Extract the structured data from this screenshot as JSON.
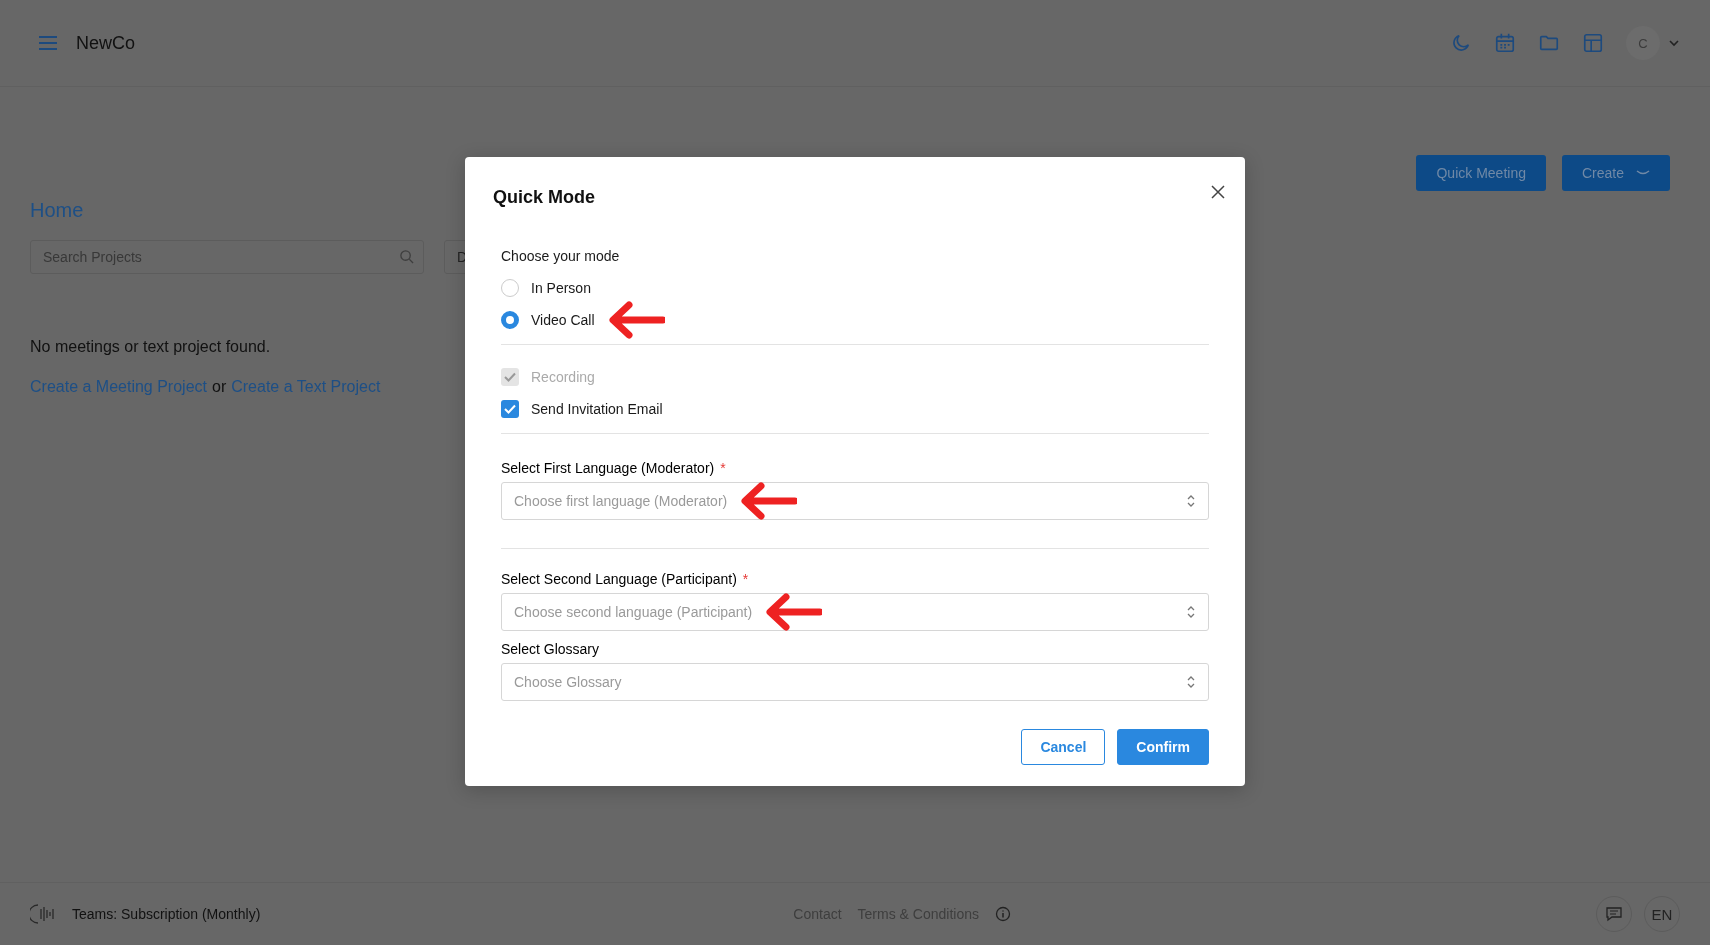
{
  "header": {
    "brand": "NewCo",
    "avatar": "C"
  },
  "actions": [
    {
      "label": "Quick Meeting",
      "kind": "plain"
    },
    {
      "label": "Create",
      "kind": "dropdown"
    }
  ],
  "page": {
    "title": "Home",
    "search": {
      "placeholder": "Search Projects"
    },
    "cut_button": "D",
    "empty_message": "No meetings or text project found.",
    "links": [
      {
        "label": "Create a Meeting Project"
      },
      {
        "label": "Create a Text Project"
      }
    ],
    "joiner": "or"
  },
  "dialog": {
    "title": "Quick Mode",
    "mode_label": "Choose your mode",
    "modes": [
      {
        "label": "In Person",
        "selected": false,
        "arrow": false
      },
      {
        "label": "Video Call",
        "selected": true,
        "arrow": true
      }
    ],
    "options": [
      {
        "label": "Recording",
        "checked": true,
        "disabled": true
      },
      {
        "label": "Send Invitation Email",
        "checked": true,
        "disabled": false
      }
    ],
    "selects": [
      {
        "label": "Select First Language (Moderator)",
        "required_mark": "*",
        "placeholder": "Choose first language (Moderator)",
        "arrow": true,
        "divider_after": true
      },
      {
        "label": "Select Second Language (Participant)",
        "required_mark": "*",
        "placeholder": "Choose second language (Participant)",
        "arrow": true,
        "divider_after": false
      },
      {
        "label": "Select Glossary",
        "placeholder": "Choose Glossary",
        "arrow": false,
        "divider_after": false
      }
    ],
    "buttons": [
      {
        "label": "Cancel",
        "kind": "secondary"
      },
      {
        "label": "Confirm",
        "kind": "primary"
      }
    ]
  },
  "footer": {
    "plan": "Teams: Subscription (Monthly)",
    "links": [
      "Contact",
      "Terms & Conditions"
    ],
    "language": "EN"
  }
}
